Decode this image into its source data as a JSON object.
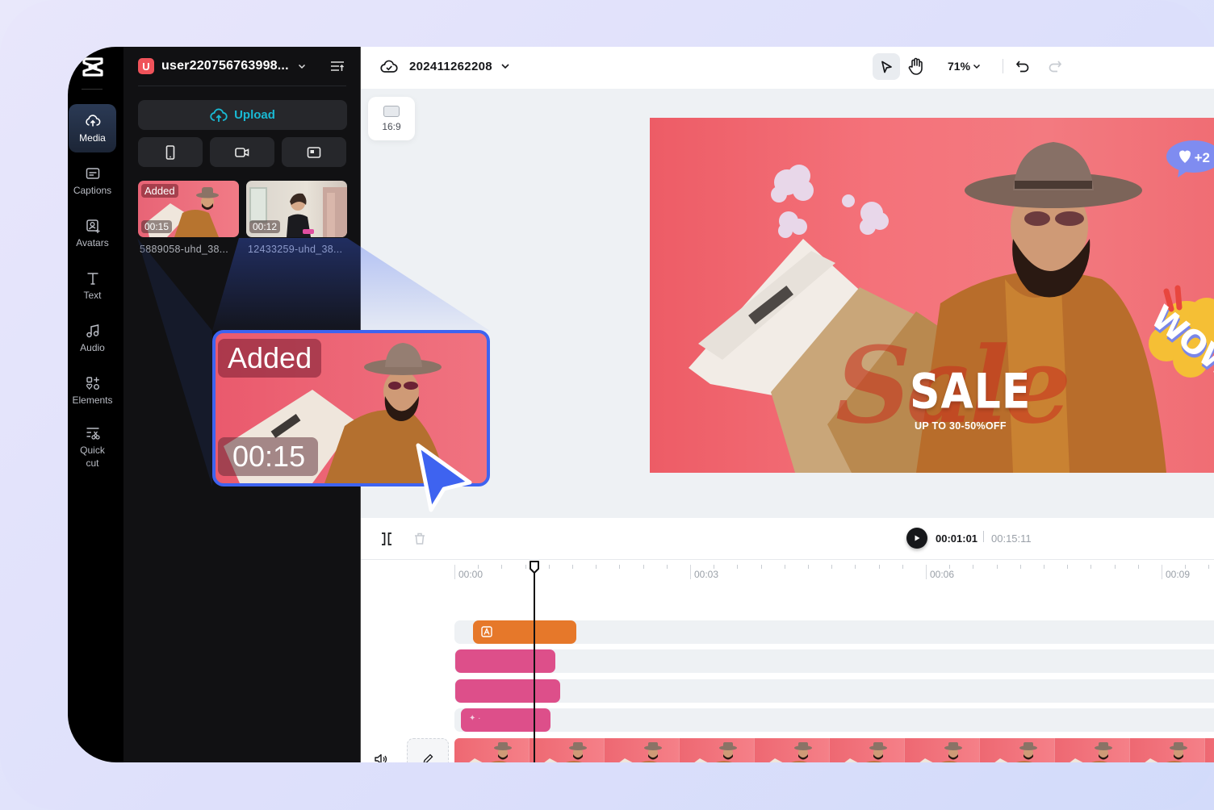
{
  "sidebar": {
    "items": [
      {
        "label": "Media",
        "icon": "cloud-upload-icon",
        "active": true
      },
      {
        "label": "Captions",
        "icon": "captions-icon"
      },
      {
        "label": "Avatars",
        "icon": "avatar-icon"
      },
      {
        "label": "Text",
        "icon": "text-icon"
      },
      {
        "label": "Audio",
        "icon": "music-note-icon"
      },
      {
        "label": "Elements",
        "icon": "elements-icon"
      },
      {
        "label": "Quick cut",
        "icon": "quick-cut-icon"
      }
    ]
  },
  "media_panel": {
    "user_initial": "U",
    "user_name": "user220756763998...",
    "upload_label": "Upload",
    "source_buttons": [
      "phone-icon",
      "camera-icon",
      "screen-record-icon"
    ],
    "items": [
      {
        "badge": "Added",
        "duration": "00:15",
        "name": "5889058-uhd_38..."
      },
      {
        "badge": "",
        "duration": "00:12",
        "name": "12433259-uhd_38..."
      }
    ]
  },
  "topbar": {
    "project_name": "202411262208",
    "zoom": "71%"
  },
  "canvas": {
    "aspect_ratio": "16:9",
    "headline": "SALE",
    "subline": "UP TO 30-50%OFF",
    "script_text": "Sale",
    "like_sticker": "+2",
    "wow_sticker": "WOW"
  },
  "timeline": {
    "current_time": "00:01:01",
    "total_time": "00:15:11",
    "ruler_labels": [
      "00:00",
      "00:03",
      "00:06",
      "00:09"
    ]
  },
  "callout": {
    "badge": "Added",
    "duration": "00:15"
  },
  "colors": {
    "accent_upload": "#19b9d3",
    "callout_border": "#3e63f0",
    "text_clip": "#e6782a",
    "effect_clip": "#dd4f8a",
    "user_badge": "#f0535a"
  }
}
